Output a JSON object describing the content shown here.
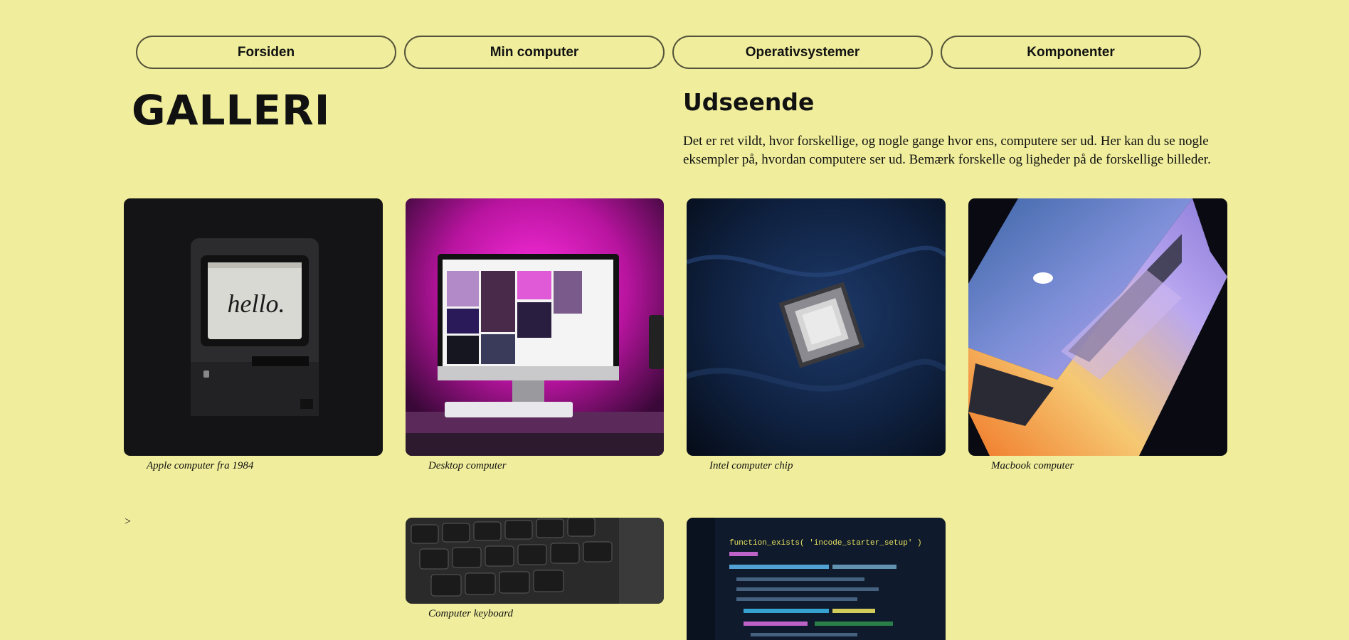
{
  "nav": {
    "items": [
      "Forsiden",
      "Min computer",
      "Operativsystemer",
      "Komponenter"
    ]
  },
  "page_title": "GALLERI",
  "section": {
    "title": "Udseende",
    "text": "Det er ret vildt, hvor forskellige, og nogle gange hvor ens, computere ser ud. Her kan du se nogle eksempler på, hvordan computere ser ud. Bemærk forskelle og ligheder på de forskellige billeder."
  },
  "gallery": {
    "captions": [
      "Apple computer fra 1984",
      "Desktop computer",
      "Intel computer chip",
      "Macbook computer",
      "Computer keyboard"
    ],
    "screen_text": "hello.",
    "code_line": "function_exists( 'incode_starter_setup' )"
  },
  "stray_text": ">",
  "colors": {
    "background": "#f0ee9c",
    "button_border": "#55533a"
  }
}
